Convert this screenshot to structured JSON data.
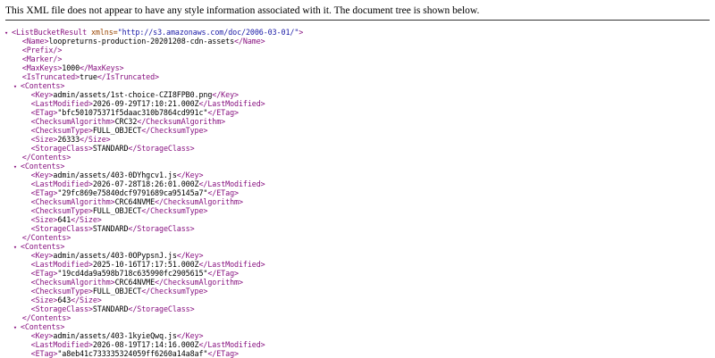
{
  "info_message": "This XML file does not appear to have any style information associated with it. The document tree is shown below.",
  "root": {
    "open_tag": "<ListBucketResult",
    "attr_name": " xmlns=",
    "attr_value": "\"http://s3.amazonaws.com/doc/2006-03-01/\"",
    "close_bracket": ">"
  },
  "fields": {
    "name": "looprеturns-production-20201208-cdn-assets",
    "prefix_tag": "<Prefix/>",
    "marker_tag": "<Marker/>",
    "max_keys": "1000",
    "is_truncated": "true"
  },
  "labels": {
    "name_open": "<Name>",
    "name_close": "</Name>",
    "maxkeys_open": "<MaxKeys>",
    "maxkeys_close": "</MaxKeys>",
    "truncated_open": "<IsTruncated>",
    "truncated_close": "</IsTruncated>",
    "contents_open": "<Contents>",
    "contents_close": "</Contents>",
    "key_open": "<Key>",
    "key_close": "</Key>",
    "lm_open": "<LastModified>",
    "lm_close": "</LastModified>",
    "etag_open": "<ETag>",
    "etag_close": "</ETag>",
    "ca_open": "<ChecksumAlgorithm>",
    "ca_close": "</ChecksumAlgorithm>",
    "ct_open": "<ChecksumType>",
    "ct_close": "</ChecksumType>",
    "size_open": "<Size>",
    "size_close": "</Size>",
    "sc_open": "<StorageClass>",
    "sc_close": "</StorageClass>"
  },
  "contents": [
    {
      "key": "admin/assets/1st-choice-CZI8FPB0.png",
      "last_modified": "2026-09-29T17:10:21.000Z",
      "etag": "\"bfc501075371f5daac310b7864cd991c\"",
      "checksum_algorithm": "CRC32",
      "checksum_type": "FULL_OBJECT",
      "size": "26333",
      "storage_class": "STANDARD"
    },
    {
      "key": "admin/assets/403-0DYhgcv1.js",
      "last_modified": "2026-07-28T18:26:01.000Z",
      "etag": "\"29fc869e75840dcf9791689ca95145a7\"",
      "checksum_algorithm": "CRC64NVME",
      "checksum_type": "FULL_OBJECT",
      "size": "641",
      "storage_class": "STANDARD"
    },
    {
      "key": "admin/assets/403-0OPypsnJ.js",
      "last_modified": "2025-10-16T17:17:51.000Z",
      "etag": "\"19cd4da9a598b718c635990fc2905615\"",
      "checksum_algorithm": "CRC64NVME",
      "checksum_type": "FULL_OBJECT",
      "size": "643",
      "storage_class": "STANDARD"
    },
    {
      "key": "admin/assets/403-1kyieQwq.js",
      "last_modified": "2026-08-19T17:14:16.000Z",
      "etag": "\"a8eb41c733335324059ff6260a14a8af\""
    }
  ],
  "colors": {
    "tag": "#881280",
    "attr_name": "#994500",
    "attr_value": "#1a1aa6",
    "text": "#000000"
  },
  "icons": {
    "expanded": "triangle-down-icon"
  }
}
